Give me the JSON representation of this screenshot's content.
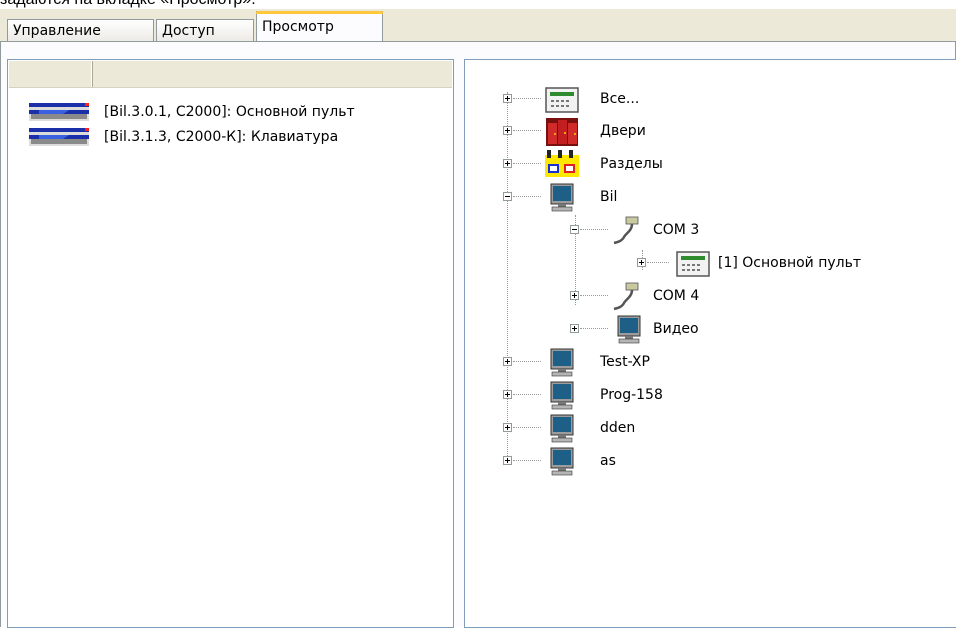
{
  "caption": "задаются на вкладке «Просмотр».",
  "tabs": [
    {
      "label": "Управление"
    },
    {
      "label": "Доступ"
    },
    {
      "label": "Просмотр",
      "active": true
    }
  ],
  "device_list": [
    {
      "label": "[Bil.3.0.1, С2000]: Основной пульт"
    },
    {
      "label": "[Bil.3.1.3, С2000-К]: Клавиатура"
    }
  ],
  "tree": [
    {
      "label": "Все...",
      "icon": "console-icon",
      "expander": "plus"
    },
    {
      "label": "Двери",
      "icon": "doors-icon",
      "expander": "plus"
    },
    {
      "label": "Разделы",
      "icon": "sections-icon",
      "expander": "plus"
    },
    {
      "label": "Bil",
      "icon": "computer-icon",
      "expander": "minus"
    },
    {
      "label": "COM 3",
      "icon": "com-port-icon",
      "expander": "minus"
    },
    {
      "label": "[1] Основной пульт",
      "icon": "console-icon",
      "expander": "plus"
    },
    {
      "label": "COM 4",
      "icon": "com-port-icon",
      "expander": "plus"
    },
    {
      "label": "Видео",
      "icon": "computer-icon",
      "expander": "plus"
    },
    {
      "label": "Test-XP",
      "icon": "computer-icon",
      "expander": "plus"
    },
    {
      "label": "Prog-158",
      "icon": "computer-icon",
      "expander": "plus"
    },
    {
      "label": "dden",
      "icon": "computer-icon",
      "expander": "plus"
    },
    {
      "label": "as",
      "icon": "computer-icon",
      "expander": "plus"
    }
  ],
  "colors": {
    "active_tab_accent": "#ffc83c",
    "pane_border": "#7f9db9"
  }
}
